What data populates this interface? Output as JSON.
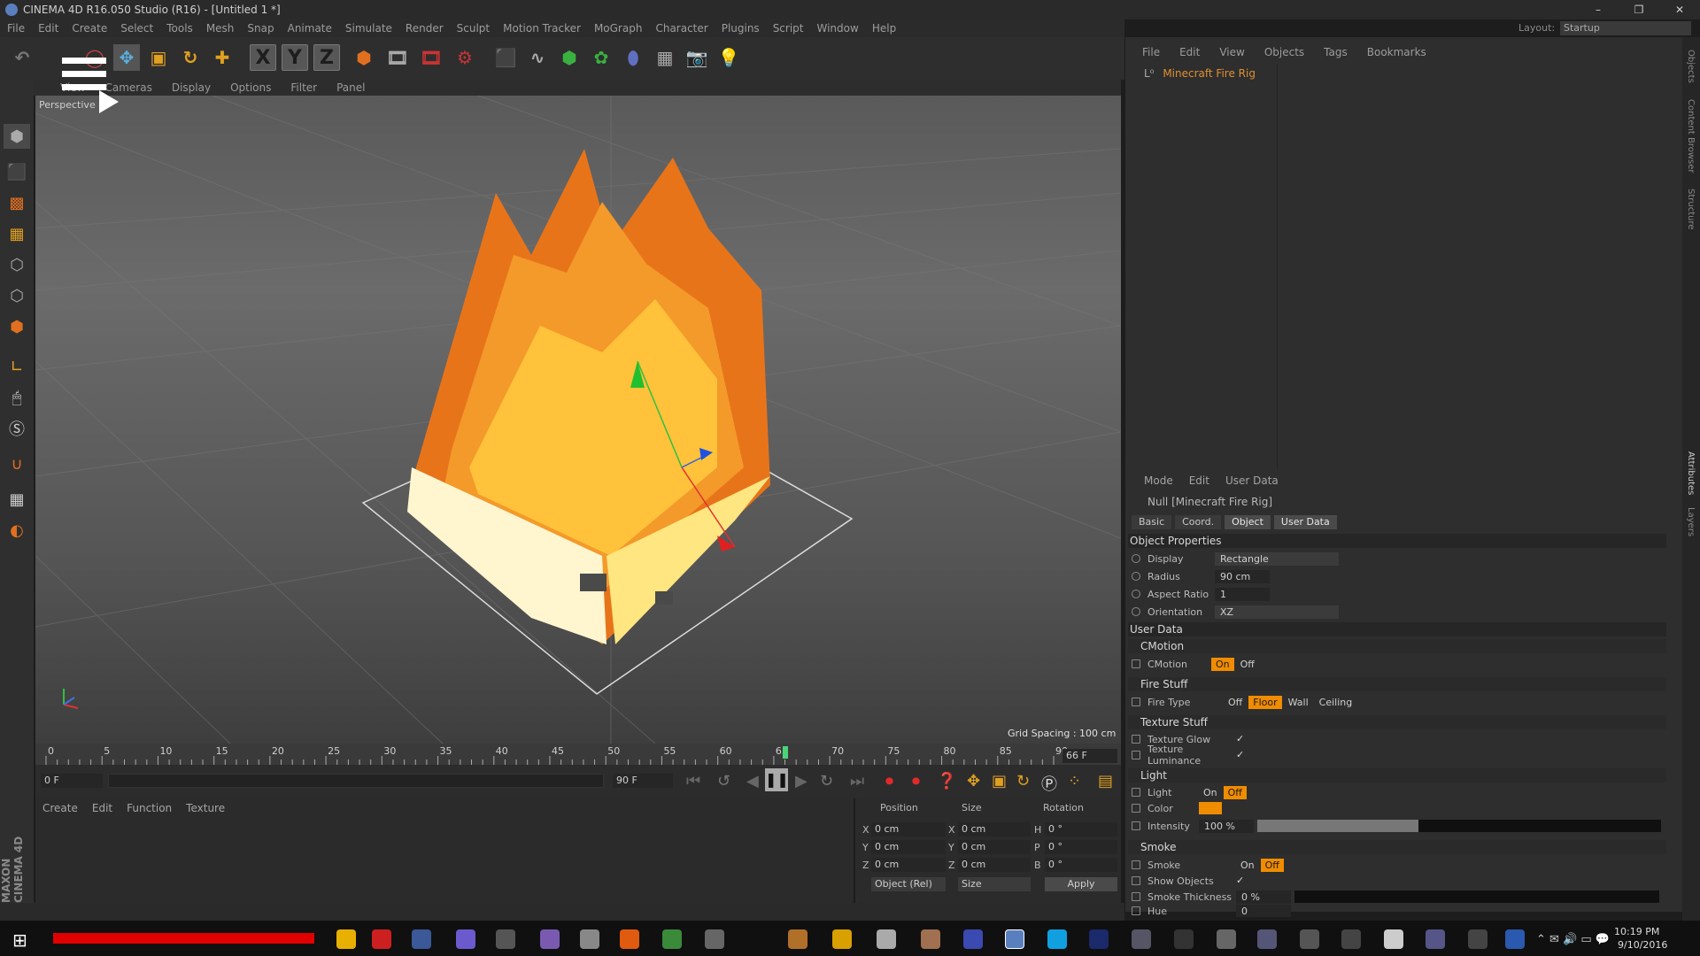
{
  "window": {
    "title": "CINEMA 4D R16.050 Studio (R16) - [Untitled 1 *]",
    "controls": [
      "–",
      "❐",
      "✕"
    ]
  },
  "menu": [
    "File",
    "Edit",
    "Create",
    "Select",
    "Tools",
    "Mesh",
    "Snap",
    "Animate",
    "Simulate",
    "Render",
    "Sculpt",
    "Motion Tracker",
    "MoGraph",
    "Character",
    "Plugins",
    "Script",
    "Window",
    "Help"
  ],
  "layout": {
    "label": "Layout:",
    "value": "Startup"
  },
  "toolbar": {
    "x": "X",
    "y": "Y",
    "z": "Z"
  },
  "viewport": {
    "menu": [
      "View",
      "Cameras",
      "Display",
      "Options",
      "Filter",
      "Panel"
    ],
    "label": "Perspective",
    "grid_spacing": "Grid Spacing : 100 cm"
  },
  "timeline": {
    "ticks": [
      "0",
      "5",
      "10",
      "15",
      "20",
      "25",
      "30",
      "35",
      "40",
      "45",
      "50",
      "55",
      "60",
      "65",
      "70",
      "75",
      "80",
      "85",
      "90"
    ],
    "current_frame_label": "66 F",
    "current_frame": 66,
    "max_frame": 90,
    "start_field": "0 F",
    "end_field": "90 F"
  },
  "materials": {
    "menu": [
      "Create",
      "Edit",
      "Function",
      "Texture"
    ]
  },
  "coords": {
    "headers": [
      "Position",
      "Size",
      "Rotation"
    ],
    "rows": [
      {
        "axis": "X",
        "pos": "0 cm",
        "size_axis": "X",
        "size": "0 cm",
        "rot_axis": "H",
        "rot": "0 °"
      },
      {
        "axis": "Y",
        "pos": "0 cm",
        "size_axis": "Y",
        "size": "0 cm",
        "rot_axis": "P",
        "rot": "0 °"
      },
      {
        "axis": "Z",
        "pos": "0 cm",
        "size_axis": "Z",
        "size": "0 cm",
        "rot_axis": "B",
        "rot": "0 °"
      }
    ],
    "mode": "Object (Rel)",
    "size_mode": "Size",
    "apply": "Apply"
  },
  "object_manager": {
    "menu": [
      "File",
      "Edit",
      "View",
      "Objects",
      "Tags",
      "Bookmarks"
    ],
    "object_name": "Minecraft Fire Rig"
  },
  "attributes": {
    "menu": [
      "Mode",
      "Edit",
      "User Data"
    ],
    "title": "Null [Minecraft Fire Rig]",
    "tabs": [
      "Basic",
      "Coord.",
      "Object",
      "User Data"
    ],
    "object_properties": "Object Properties",
    "display_label": "Display",
    "display_value": "Rectangle",
    "radius_label": "Radius",
    "radius_value": "90 cm",
    "aspect_label": "Aspect Ratio",
    "aspect_value": "1",
    "orientation_label": "Orientation",
    "orientation_value": "XZ",
    "user_data": "User Data",
    "cmotion_group": "CMotion",
    "cmotion_label": "CMotion",
    "on": "On",
    "off": "Off",
    "fire_group": "Fire Stuff",
    "fire_type_label": "Fire Type",
    "fire_types": [
      "Off",
      "Floor",
      "Wall",
      "Ceiling"
    ],
    "texture_group": "Texture Stuff",
    "texture_glow": "Texture Glow",
    "texture_luminance": "Texture Luminance",
    "light_group": "Light",
    "light_label": "Light",
    "color_label": "Color",
    "light_color": "#f08c00",
    "intensity_label": "Intensity",
    "intensity_value": "100 %",
    "intensity_level": 1.0,
    "smoke_group": "Smoke",
    "smoke_label": "Smoke",
    "show_objects": "Show Objects",
    "smoke_thickness": "Smoke Thickness",
    "smoke_thickness_value": "0 %",
    "hue_label": "Hue",
    "hue_value": "0"
  },
  "right_strip": [
    "Objects",
    "Content Browser",
    "Structure",
    "Attributes",
    "Layers"
  ],
  "taskbar": {
    "time": "10:19 PM",
    "date": "9/10/2016"
  },
  "brand": "MAXON CINEMA 4D",
  "colors": {
    "accent": "#f08c00",
    "fire_outer": "#e8741a",
    "fire_inner": "#ffe680"
  }
}
